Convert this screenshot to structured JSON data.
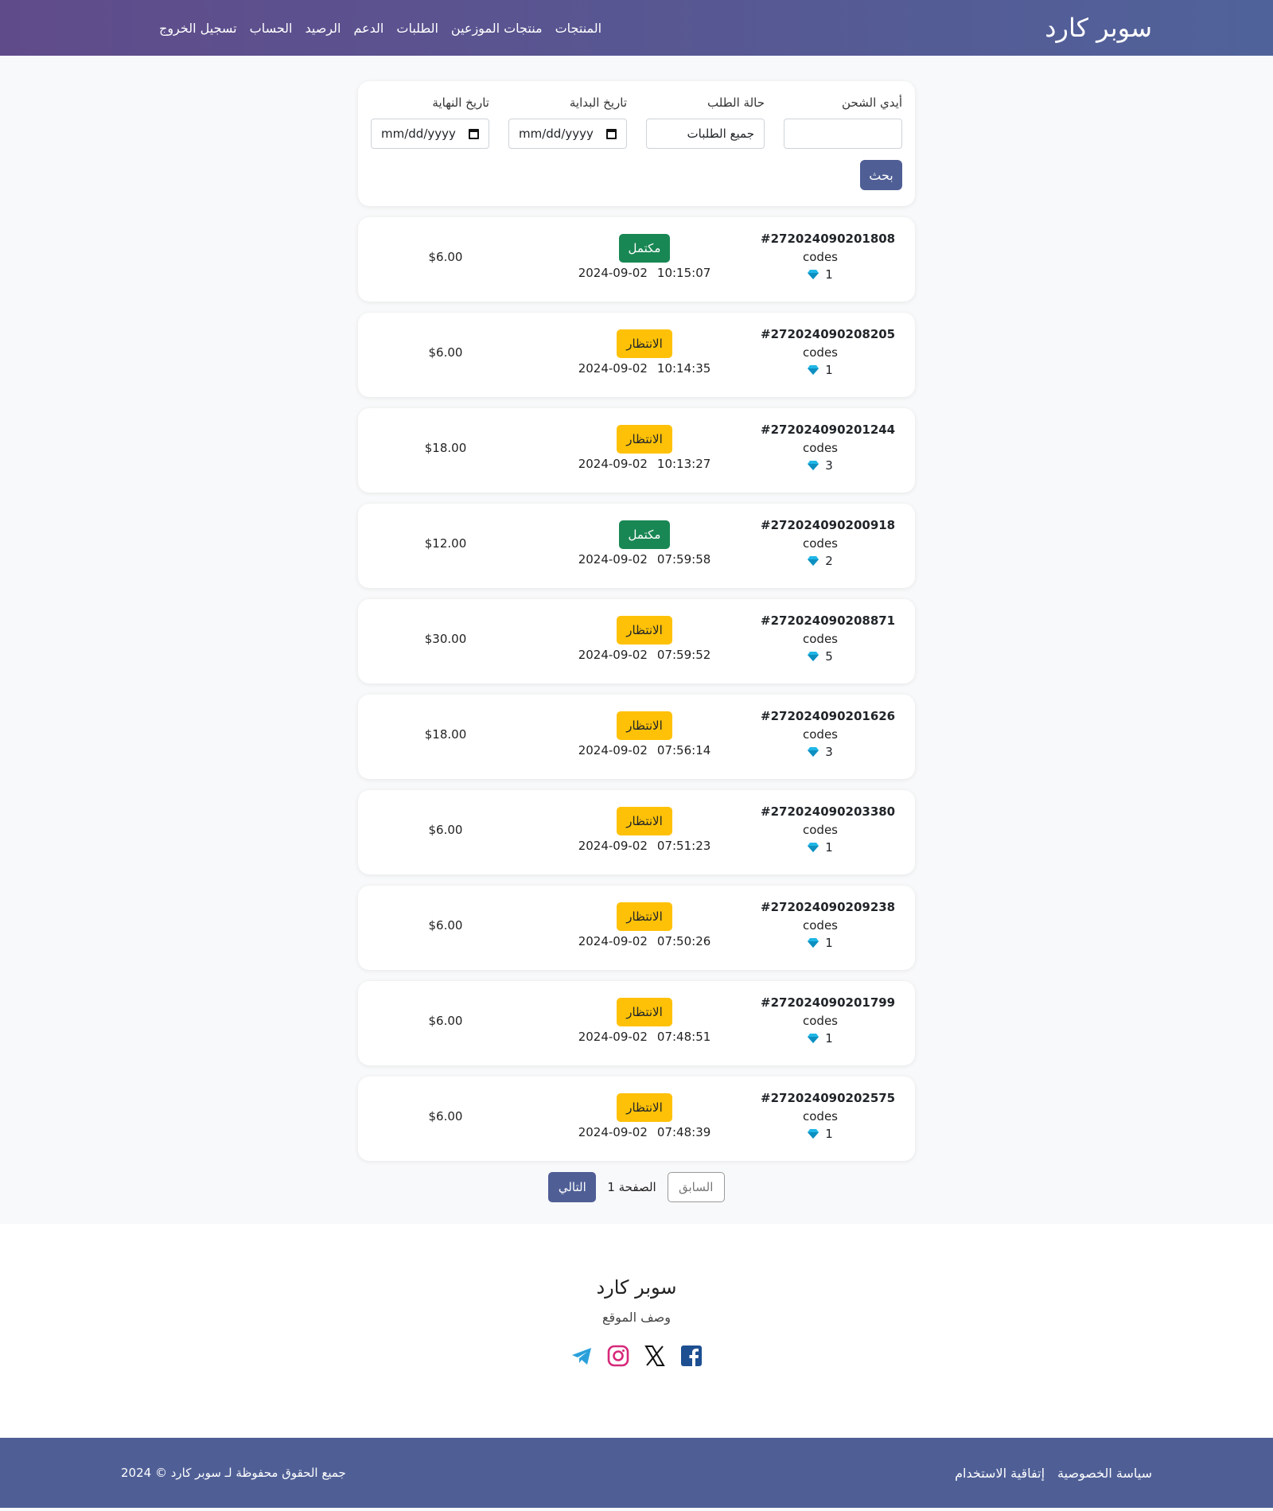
{
  "header": {
    "brand": "سوبر كارد",
    "nav": [
      "المنتجات",
      "منتجات الموزعين",
      "الطلبات",
      "الدعم",
      "الرصيد",
      "الحساب",
      "تسجيل الخروج"
    ]
  },
  "filters": {
    "charge_id_label": "أيدي الشحن",
    "charge_id_value": "",
    "status_label": "حالة الطلب",
    "status_value": "جميع الطلبات",
    "start_label": "تاريخ البداية",
    "start_value": "mm/dd/yyyy",
    "end_label": "تاريخ النهاية",
    "end_value": "mm/dd/yyyy",
    "search_label": "بحث"
  },
  "orders": [
    {
      "id": "#272024090201808",
      "type": "codes",
      "qty": "1",
      "status": "مكتمل",
      "state": "done",
      "date": "2024-09-02",
      "time": "10:15:07",
      "price": "$6.00"
    },
    {
      "id": "#272024090208205",
      "type": "codes",
      "qty": "1",
      "status": "الانتظار",
      "state": "pending",
      "date": "2024-09-02",
      "time": "10:14:35",
      "price": "$6.00"
    },
    {
      "id": "#272024090201244",
      "type": "codes",
      "qty": "3",
      "status": "الانتظار",
      "state": "pending",
      "date": "2024-09-02",
      "time": "10:13:27",
      "price": "$18.00"
    },
    {
      "id": "#272024090200918",
      "type": "codes",
      "qty": "2",
      "status": "مكتمل",
      "state": "done",
      "date": "2024-09-02",
      "time": "07:59:58",
      "price": "$12.00"
    },
    {
      "id": "#272024090208871",
      "type": "codes",
      "qty": "5",
      "status": "الانتظار",
      "state": "pending",
      "date": "2024-09-02",
      "time": "07:59:52",
      "price": "$30.00"
    },
    {
      "id": "#272024090201626",
      "type": "codes",
      "qty": "3",
      "status": "الانتظار",
      "state": "pending",
      "date": "2024-09-02",
      "time": "07:56:14",
      "price": "$18.00"
    },
    {
      "id": "#272024090203380",
      "type": "codes",
      "qty": "1",
      "status": "الانتظار",
      "state": "pending",
      "date": "2024-09-02",
      "time": "07:51:23",
      "price": "$6.00"
    },
    {
      "id": "#272024090209238",
      "type": "codes",
      "qty": "1",
      "status": "الانتظار",
      "state": "pending",
      "date": "2024-09-02",
      "time": "07:50:26",
      "price": "$6.00"
    },
    {
      "id": "#272024090201799",
      "type": "codes",
      "qty": "1",
      "status": "الانتظار",
      "state": "pending",
      "date": "2024-09-02",
      "time": "07:48:51",
      "price": "$6.00"
    },
    {
      "id": "#272024090202575",
      "type": "codes",
      "qty": "1",
      "status": "الانتظار",
      "state": "pending",
      "date": "2024-09-02",
      "time": "07:48:39",
      "price": "$6.00"
    }
  ],
  "pagination": {
    "next": "التالي",
    "page_label": "الصفحة 1",
    "prev": "السابق"
  },
  "footer": {
    "brand": "سوبر كارد",
    "description": "وصف الموقع",
    "social": [
      "facebook-icon",
      "x-icon",
      "instagram-icon",
      "telegram-icon"
    ],
    "privacy": "سياسة الخصوصية",
    "terms": "إتفاقية الاستخدام",
    "copyright": "جميع الحقوق محفوظة لـ سوبر كارد © 2024"
  },
  "colors": {
    "primary": "#4f5f96",
    "success": "#198754",
    "warning": "#ffc107",
    "gem": "#1fb6e6"
  }
}
